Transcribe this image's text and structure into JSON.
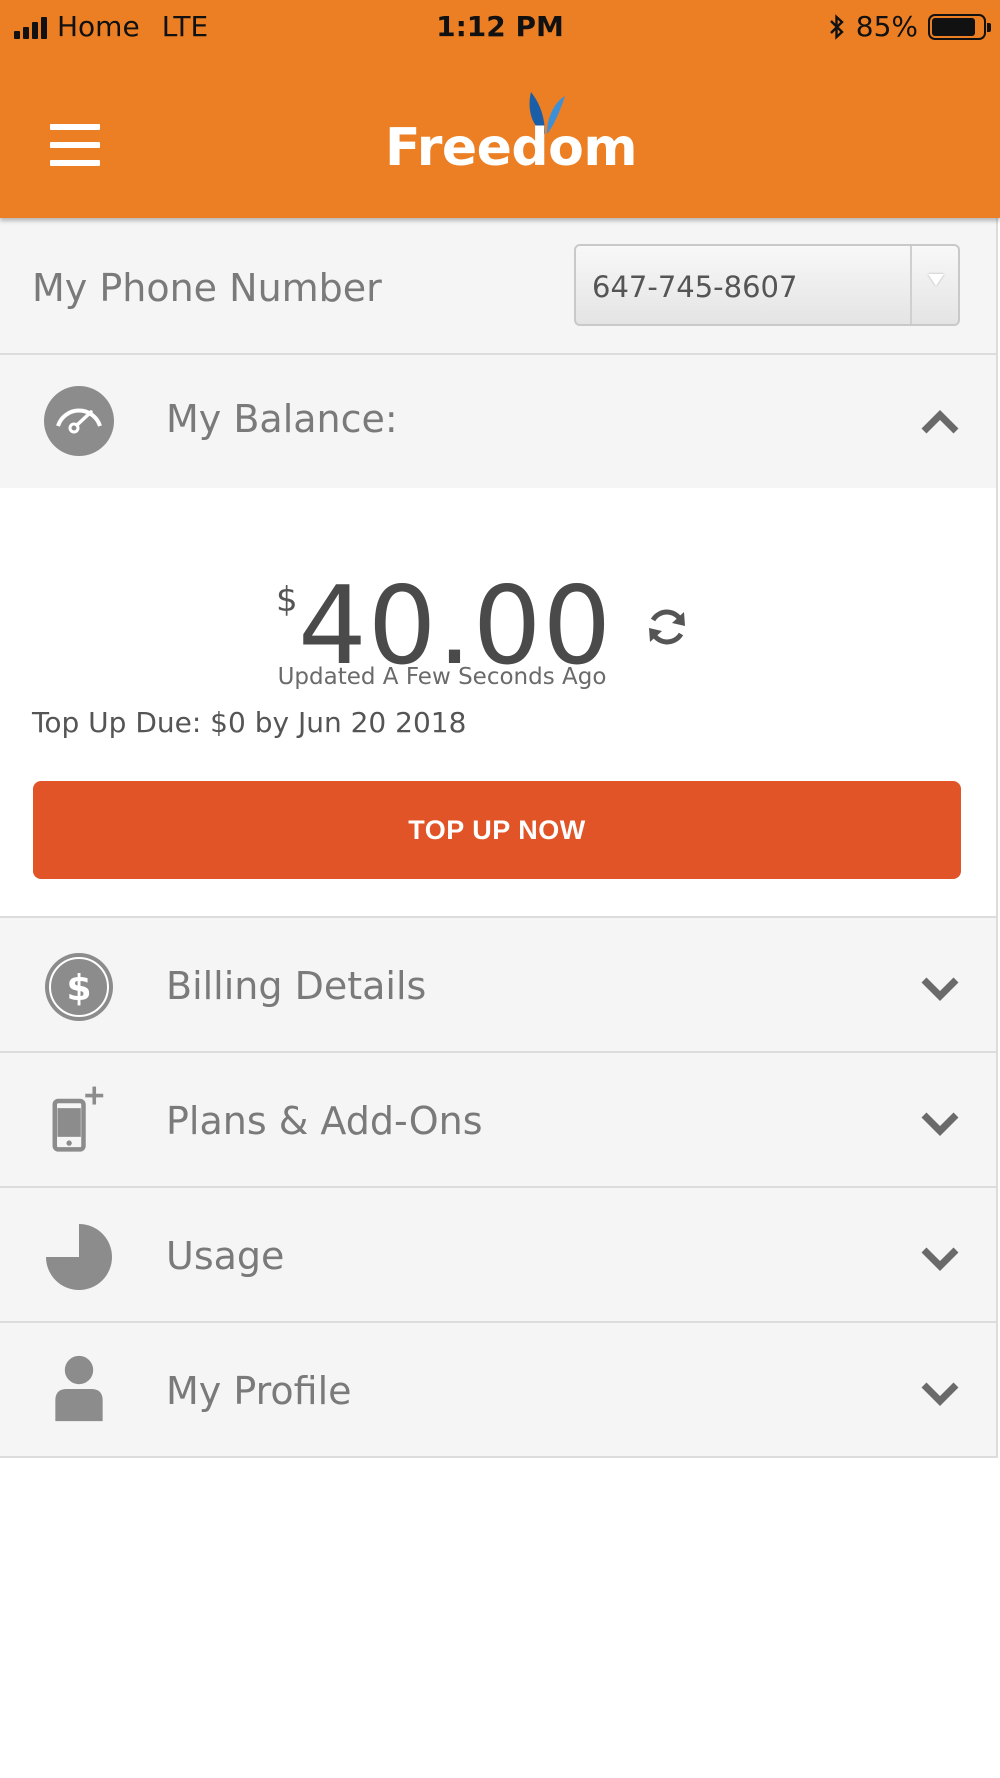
{
  "status_bar": {
    "carrier": "Home",
    "network": "LTE",
    "time": "1:12 PM",
    "battery": "85%",
    "battery_level": 0.85
  },
  "header": {
    "logo_text": "Freedom",
    "menu_icon": "hamburger-icon",
    "brand_color": "#ec7f24"
  },
  "phone": {
    "label": "My Phone Number",
    "selected_number": "647-745-8607"
  },
  "balance": {
    "label": "My Balance:",
    "currency_symbol": "$",
    "amount": "40.00",
    "updated_text": "Updated A Few Seconds Ago",
    "top_up_due": "Top Up Due: $0 by Jun 20 2018",
    "top_up_button": "TOP UP NOW",
    "button_color": "#e05427"
  },
  "sections": {
    "billing": {
      "label": "Billing Details",
      "icon": "dollar-icon"
    },
    "plans": {
      "label": "Plans & Add-Ons",
      "icon": "phone-plus-icon"
    },
    "usage": {
      "label": "Usage",
      "icon": "pie-chart-icon"
    },
    "profile": {
      "label": "My Profile",
      "icon": "user-icon"
    }
  }
}
